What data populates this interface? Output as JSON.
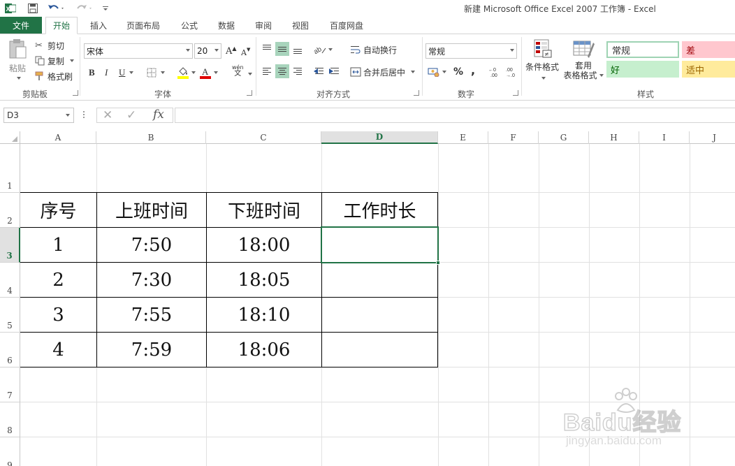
{
  "window": {
    "title": "新建 Microsoft Office Excel 2007 工作簿 - Excel"
  },
  "tabs": {
    "file": "文件",
    "items": [
      "开始",
      "插入",
      "页面布局",
      "公式",
      "数据",
      "审阅",
      "视图",
      "百度网盘"
    ],
    "active": "开始"
  },
  "ribbon": {
    "clipboard": {
      "paste": "粘贴",
      "cut": "剪切",
      "copy": "复制",
      "format_painter": "格式刷",
      "label": "剪贴板"
    },
    "font": {
      "name": "宋体",
      "size": "20",
      "label": "字体",
      "bold": "B",
      "italic": "I",
      "underline": "U",
      "grow": "A",
      "shrink": "A",
      "phonetic": "wén"
    },
    "alignment": {
      "wrap_text": "自动换行",
      "merge_center": "合并后居中",
      "label": "对齐方式"
    },
    "number": {
      "format": "常规",
      "percent": "%",
      "comma": ",",
      "label": "数字"
    },
    "styles": {
      "conditional": "条件格式",
      "table_format_1": "套用",
      "table_format_2": "表格格式",
      "normal": "常规",
      "bad": "差",
      "good": "好",
      "neutral": "适中",
      "label": "样式"
    }
  },
  "formula_bar": {
    "name_box": "D3",
    "fx": "fx",
    "formula": ""
  },
  "sheet": {
    "columns": [
      "A",
      "B",
      "C",
      "D",
      "E",
      "F",
      "G",
      "H",
      "I",
      "J"
    ],
    "selected_column": "D",
    "rows": [
      "1",
      "2",
      "3",
      "4",
      "5",
      "6",
      "7",
      "8",
      "9"
    ],
    "selected_row": "3",
    "table": {
      "headers": [
        "序号",
        "上班时间",
        "下班时间",
        "工作时长"
      ],
      "rows": [
        [
          "1",
          "7:50",
          "18:00",
          ""
        ],
        [
          "2",
          "7:30",
          "18:05",
          ""
        ],
        [
          "3",
          "7:55",
          "18:10",
          ""
        ],
        [
          "4",
          "7:59",
          "18:06",
          ""
        ]
      ]
    }
  },
  "watermark": {
    "brand": "Baidu经验",
    "url": "jingyan.baidu.com"
  },
  "colors": {
    "accent": "#217346",
    "bad_fill": "#ffc7ce",
    "good_fill": "#c6efce",
    "neutral_fill": "#ffeb9c"
  }
}
